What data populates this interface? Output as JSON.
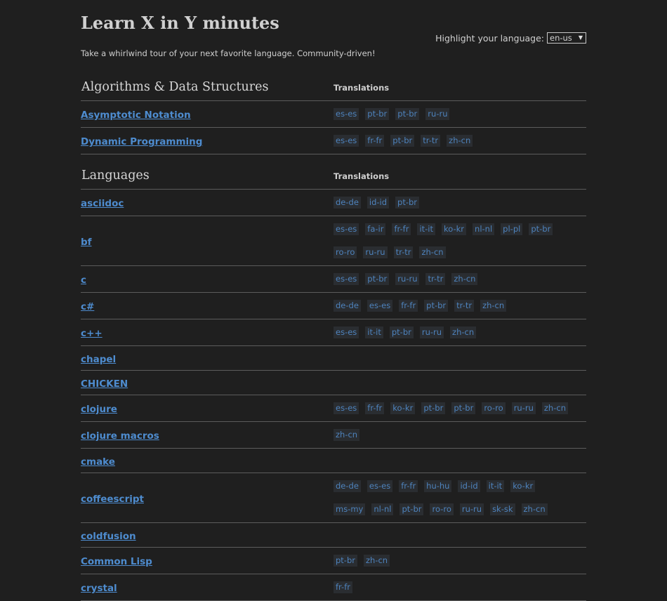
{
  "header": {
    "title": "Learn X in Y minutes",
    "tagline": "Take a whirlwind tour of your next favorite language. Community-driven!",
    "highlight_label": "Highlight your language:",
    "highlight_value": "en-us"
  },
  "sections": [
    {
      "title": "Algorithms & Data Structures",
      "translations_label": "Translations",
      "rows": [
        {
          "name": "Asymptotic Notation",
          "translations": [
            "es-es",
            "pt-br",
            "pt-br",
            "ru-ru"
          ]
        },
        {
          "name": "Dynamic Programming",
          "translations": [
            "es-es",
            "fr-fr",
            "pt-br",
            "tr-tr",
            "zh-cn"
          ]
        }
      ]
    },
    {
      "title": "Languages",
      "translations_label": "Translations",
      "rows": [
        {
          "name": "asciidoc",
          "translations": [
            "de-de",
            "id-id",
            "pt-br"
          ]
        },
        {
          "name": "bf",
          "translations": [
            "es-es",
            "fa-ir",
            "fr-fr",
            "it-it",
            "ko-kr",
            "nl-nl",
            "pl-pl",
            "pt-br",
            "ro-ro",
            "ru-ru",
            "tr-tr",
            "zh-cn"
          ]
        },
        {
          "name": "c",
          "translations": [
            "es-es",
            "pt-br",
            "ru-ru",
            "tr-tr",
            "zh-cn"
          ]
        },
        {
          "name": "c#",
          "translations": [
            "de-de",
            "es-es",
            "fr-fr",
            "pt-br",
            "tr-tr",
            "zh-cn"
          ]
        },
        {
          "name": "c++",
          "translations": [
            "es-es",
            "it-it",
            "pt-br",
            "ru-ru",
            "zh-cn"
          ]
        },
        {
          "name": "chapel",
          "translations": []
        },
        {
          "name": "CHICKEN",
          "translations": []
        },
        {
          "name": "clojure",
          "translations": [
            "es-es",
            "fr-fr",
            "ko-kr",
            "pt-br",
            "pt-br",
            "ro-ro",
            "ru-ru",
            "zh-cn"
          ]
        },
        {
          "name": "clojure macros",
          "translations": [
            "zh-cn"
          ]
        },
        {
          "name": "cmake",
          "translations": []
        },
        {
          "name": "coffeescript",
          "translations": [
            "de-de",
            "es-es",
            "fr-fr",
            "hu-hu",
            "id-id",
            "it-it",
            "ko-kr",
            "ms-my",
            "nl-nl",
            "pt-br",
            "ro-ro",
            "ru-ru",
            "sk-sk",
            "zh-cn"
          ]
        },
        {
          "name": "coldfusion",
          "translations": []
        },
        {
          "name": "Common Lisp",
          "translations": [
            "pt-br",
            "zh-cn"
          ]
        },
        {
          "name": "crystal",
          "translations": [
            "fr-fr"
          ]
        }
      ]
    }
  ]
}
